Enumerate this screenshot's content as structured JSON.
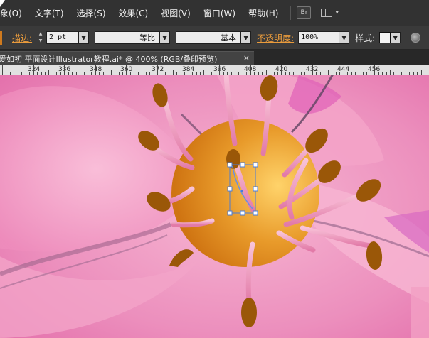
{
  "menu": [
    "象(O)",
    "文字(T)",
    "选择(S)",
    "效果(C)",
    "视图(V)",
    "窗口(W)",
    "帮助(H)"
  ],
  "bridge_label": "Br",
  "control": {
    "stroke_label": "描边:",
    "stroke_value": "2 pt",
    "profile_label": "等比",
    "brush_label": "基本",
    "opacity_label": "不透明度:",
    "opacity_value": "100%",
    "style_label": "样式:"
  },
  "document": {
    "tab_title": "爱如初  平面设计Illustrator教程.ai* @ 400% (RGB/叠印预览)",
    "close_symbol": "×"
  },
  "ruler": {
    "labels": [
      "324",
      "336",
      "348",
      "360",
      "372",
      "384",
      "396",
      "408",
      "420",
      "432",
      "444",
      "456"
    ]
  },
  "colors": {
    "petal": "#e77fb2",
    "center": "#e8a030",
    "anther": "#9a5708",
    "filament": "#f3a9c7"
  }
}
